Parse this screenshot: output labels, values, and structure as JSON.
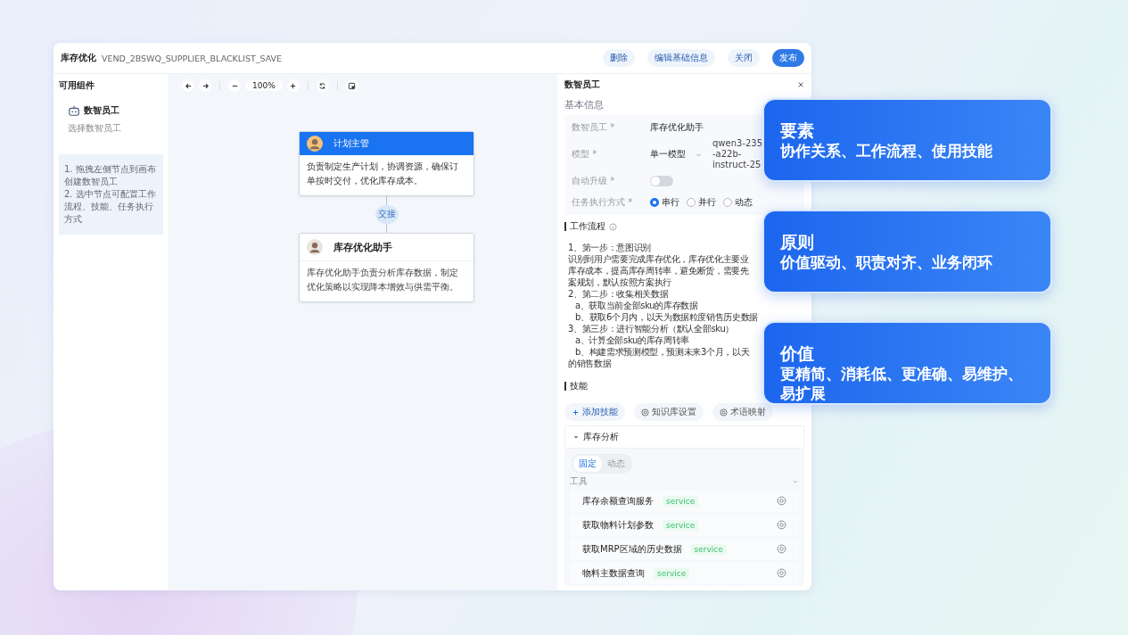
{
  "header": {
    "title": "库存优化",
    "code": "VEND_2BSWQ_SUPPLIER_BLACKLIST_SAVE",
    "buttons": [
      {
        "label": "删除",
        "kind": "plain"
      },
      {
        "label": "编辑基础信息",
        "kind": "plain"
      },
      {
        "label": "关闭",
        "kind": "plain"
      },
      {
        "label": "发布",
        "kind": "primary"
      }
    ]
  },
  "components_panel": {
    "title": "可用组件",
    "item": {
      "label": "数智员工",
      "description": "选择数智员工"
    },
    "tips": [
      "1. 拖拽左侧节点到画布创建数智员工",
      "2. 选中节点可配置工作流程、技能、任务执行方式"
    ]
  },
  "canvas": {
    "zoom": "100%",
    "edge_label": "交接",
    "nodes": [
      {
        "title": "计划主管",
        "kind": "supervisor",
        "description": "负责制定生产计划，协调资源，确保订单按时交付，优化库存成本。"
      },
      {
        "title": "库存优化助手",
        "kind": "assistant",
        "description": "库存优化助手负责分析库存数据，制定优化策略以实现降本增效与供需平衡。"
      }
    ]
  },
  "details": {
    "title": "数智员工",
    "section": "基本信息",
    "fields": [
      {
        "label": "数智员工 *",
        "kind": "text",
        "value": "库存优化助手"
      },
      {
        "label": "模型 *",
        "kind": "select",
        "value": "单一模型",
        "detail_lines": [
          "qwen3-235",
          "-a22b-",
          "instruct-25"
        ]
      },
      {
        "label": "自动升级 *",
        "kind": "switch",
        "on": false
      },
      {
        "label": "任务执行方式 *",
        "kind": "radio",
        "options": [
          {
            "label": "串行",
            "selected": true
          },
          {
            "label": "并行",
            "selected": false
          },
          {
            "label": "动态",
            "selected": false
          }
        ]
      }
    ],
    "workflow": {
      "title": "工作流程",
      "lines": [
        {
          "text": "1、第一步：意图识别",
          "indented": false
        },
        {
          "text": "识别到用户需要完成库存优化，库存优化主要业",
          "indented": false
        },
        {
          "text": "库存成本，提高库存周转率，避免断货，需要先",
          "indented": false
        },
        {
          "text": "案规划，默认按照方案执行",
          "indented": false
        },
        {
          "text": "2、第二步：收集相关数据",
          "indented": false
        },
        {
          "text": "a、获取当前全部sku的库存数据",
          "indented": true
        },
        {
          "text": "b、获取6个月内，以天为数据粒度销售历史数据",
          "indented": true
        },
        {
          "text": "3、第三步：进行智能分析（默认全部sku）",
          "indented": false
        },
        {
          "text": "a、计算全部sku的库存周转率",
          "indented": true
        },
        {
          "text": "b、构建需求预测模型，预测未来3个月，以天",
          "indented": true
        },
        {
          "text": "的销售数据",
          "indented": false
        }
      ]
    },
    "skills": {
      "title": "技能",
      "actions": [
        {
          "label": "添加技能",
          "kind": "add"
        },
        {
          "label": "知识库设置",
          "kind": "settings"
        },
        {
          "label": "术语映射",
          "kind": "settings"
        }
      ],
      "group": {
        "name": "库存分析",
        "expanded": true,
        "modes": [
          {
            "label": "固定",
            "selected": true
          },
          {
            "label": "动态",
            "selected": false
          }
        ],
        "tools_label": "工具",
        "tools": [
          {
            "name": "库存余额查询服务",
            "tag": "service"
          },
          {
            "name": "获取物料计划参数",
            "tag": "service"
          },
          {
            "name": "获取MRP区域的历史数据",
            "tag": "service"
          },
          {
            "name": "物料主数据查询",
            "tag": "service"
          }
        ]
      }
    }
  },
  "callouts": [
    {
      "title": "要素",
      "text": "协作关系、工作流程、使用技能"
    },
    {
      "title": "原则",
      "text": "价值驱动、职责对齐、业务闭环"
    },
    {
      "title": "价值",
      "text": "更精简、消耗低、更准确、易维护、易扩展"
    }
  ]
}
